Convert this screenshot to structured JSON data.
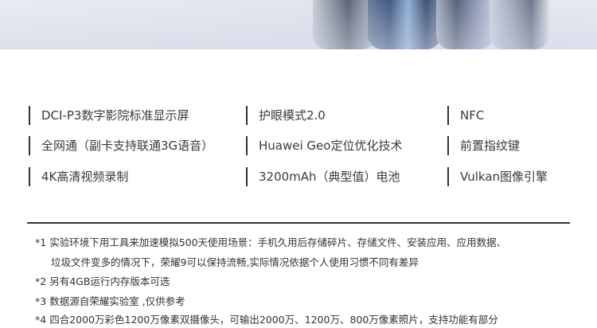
{
  "features": [
    {
      "label": "DCI-P3数字影院标准显示屏"
    },
    {
      "label": "护眼模式2.0"
    },
    {
      "label": "NFC"
    },
    {
      "label": "全网通（副卡支持联通3G语音）"
    },
    {
      "label": "Huawei Geo定位优化技术"
    },
    {
      "label": "前置指纹键"
    },
    {
      "label": "4K高清视频录制"
    },
    {
      "label": "3200mAh（典型值）电池"
    },
    {
      "label": "Vulkan图像引擎"
    }
  ],
  "footnotes": [
    {
      "num": "*1",
      "text": "实验环境下用工具来加速模拟500天使用场景：手机久用后存储碎片、存储文件、安装应用、应用数据、",
      "continuation": "垃圾文件变多的情况下，荣耀9可以保持流畅,实际情况依据个人使用习惯不同有差异"
    },
    {
      "num": "*2",
      "text": "另有4GB运行内存版本可选"
    },
    {
      "num": "*3",
      "text": "数据源自荣耀实验室 ,仅供参考"
    },
    {
      "num": "*4",
      "text": "四合2000万彩色1200万像素双摄像头，可输出2000万、1200万、800万像素照片，支持功能有部分"
    }
  ]
}
